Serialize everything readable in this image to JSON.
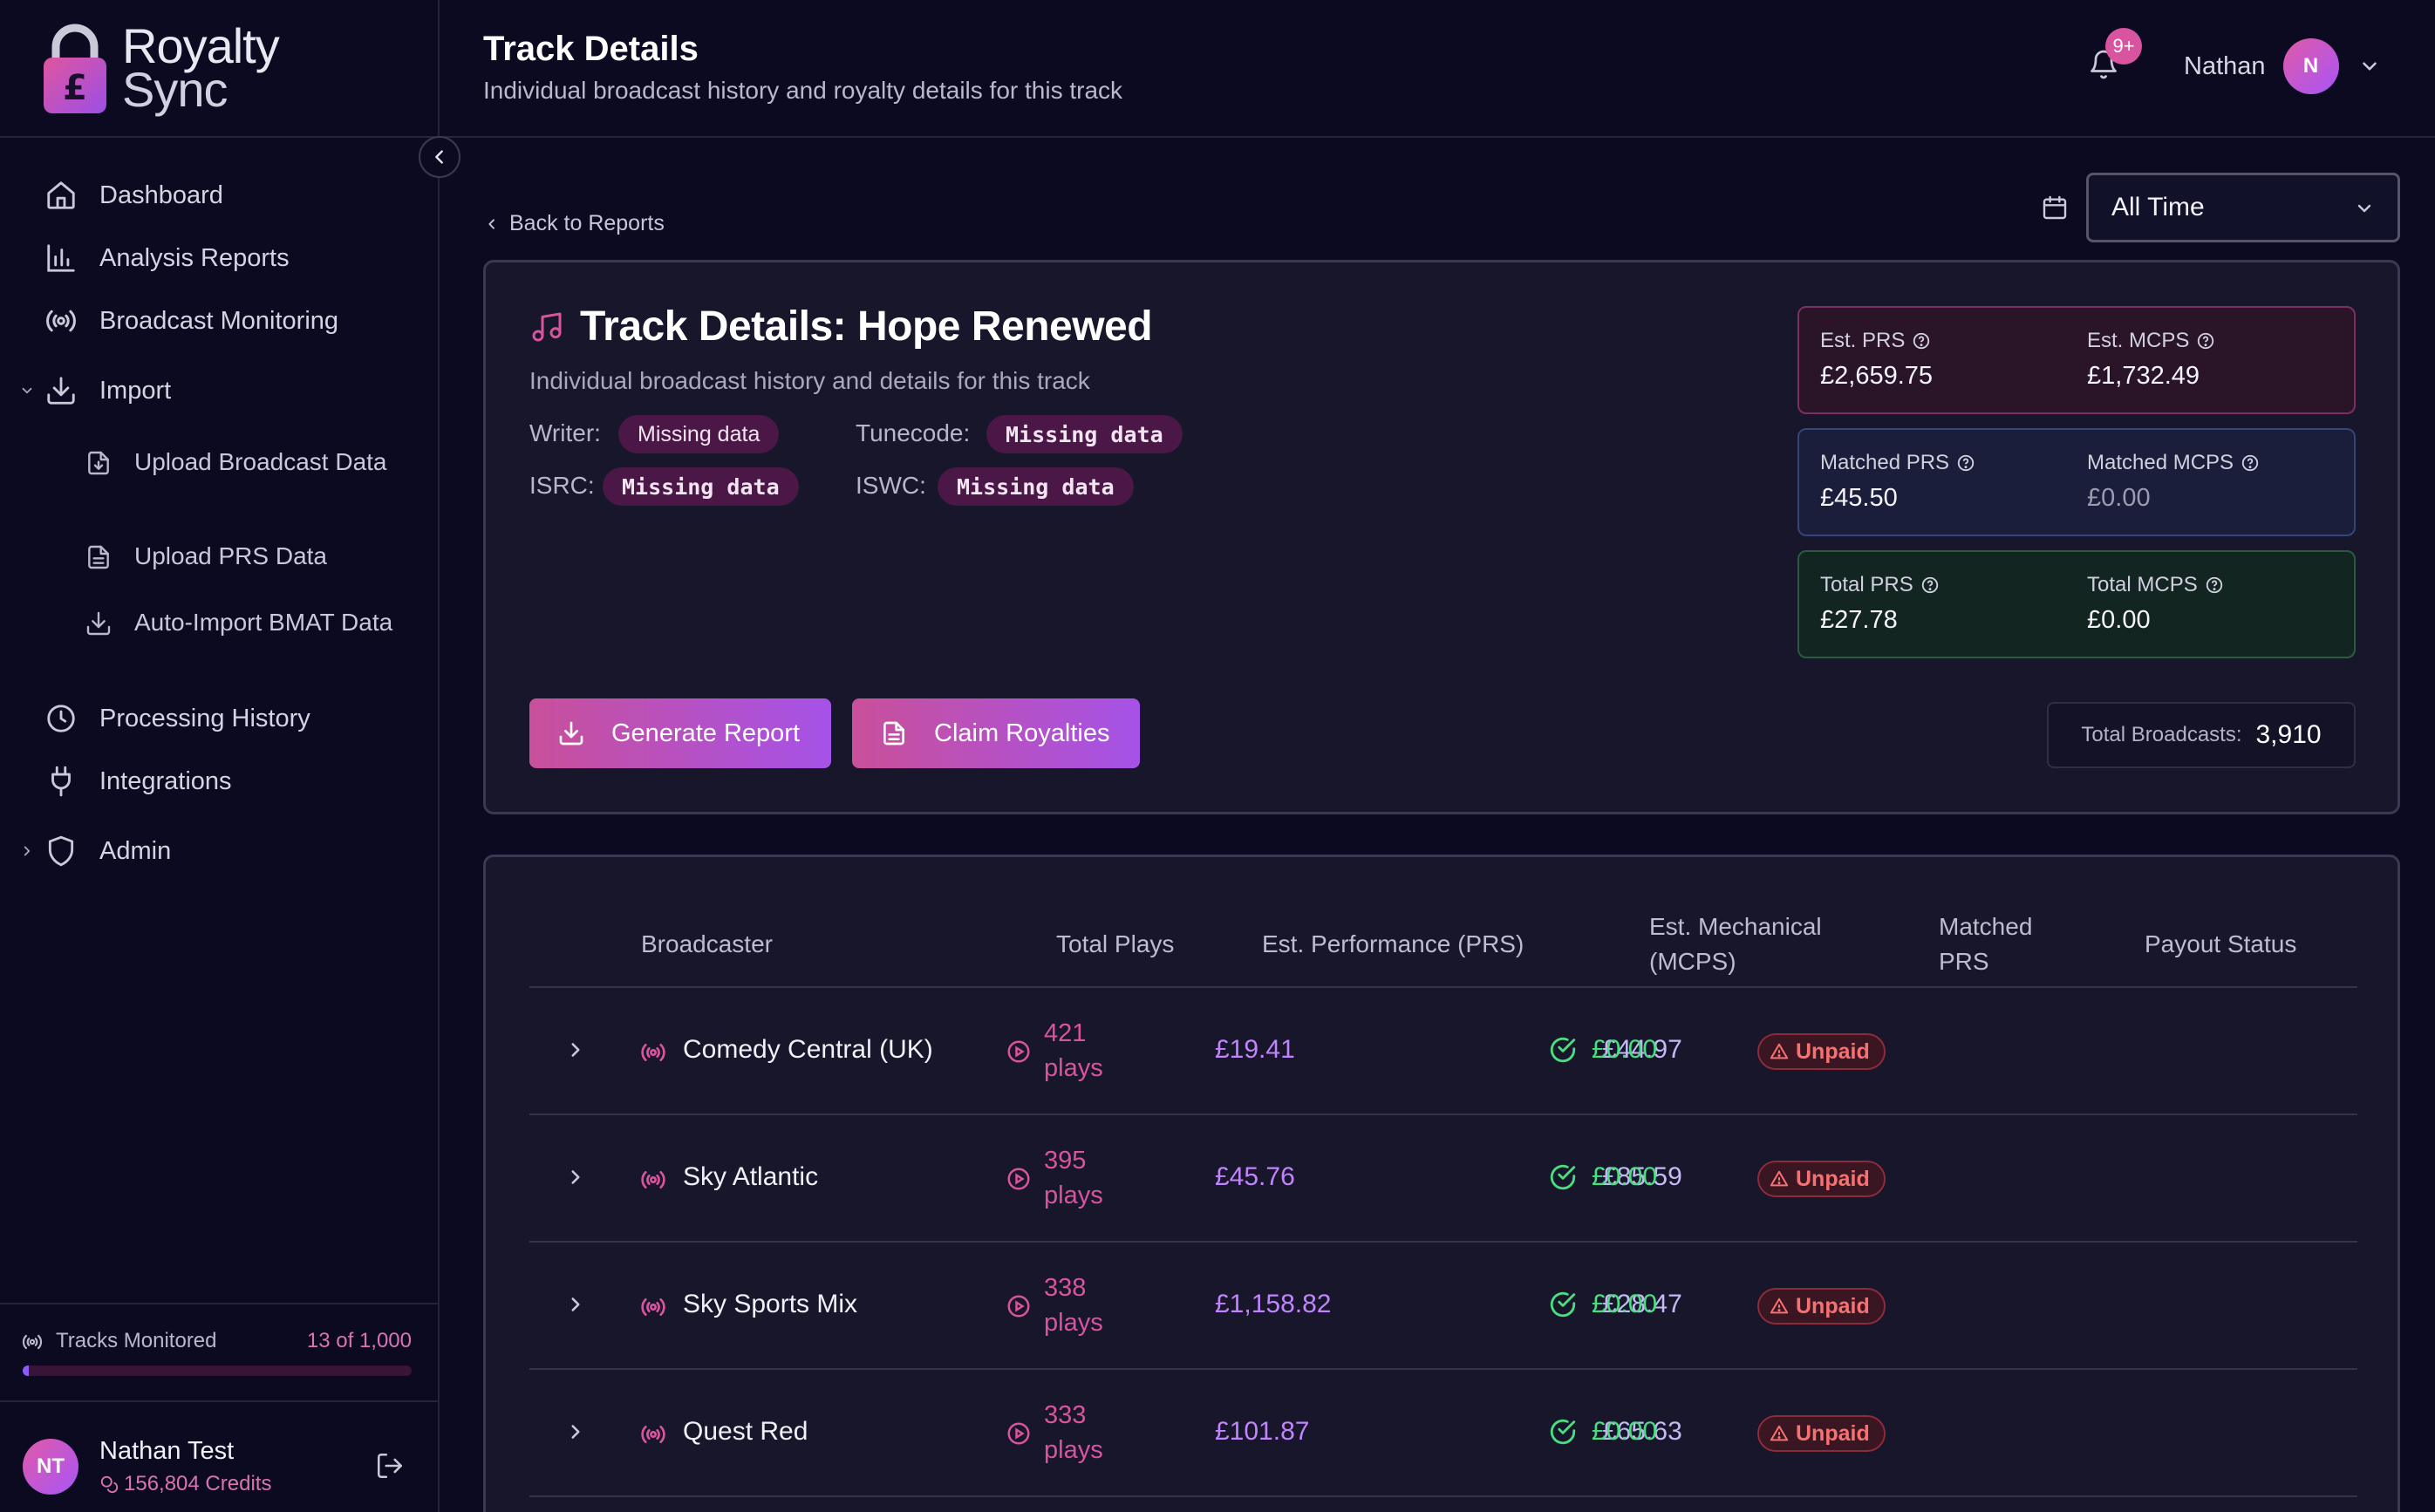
{
  "app": {
    "name_line1": "Royalty",
    "name_line2": "Sync"
  },
  "sidebar": {
    "items": [
      {
        "label": "Dashboard",
        "icon": "home-icon"
      },
      {
        "label": "Analysis Reports",
        "icon": "bar-chart-icon"
      },
      {
        "label": "Broadcast Monitoring",
        "icon": "radio-icon"
      },
      {
        "label": "Import",
        "icon": "download-icon",
        "expanded": true,
        "children": [
          {
            "label": "Upload Broadcast Data",
            "icon": "file-download-icon"
          },
          {
            "label": "Upload PRS Data",
            "icon": "file-text-icon"
          },
          {
            "label": "Auto-Import BMAT Data",
            "icon": "download-icon"
          }
        ]
      },
      {
        "label": "Processing History",
        "icon": "clock-icon"
      },
      {
        "label": "Integrations",
        "icon": "plug-icon"
      },
      {
        "label": "Admin",
        "icon": "shield-icon",
        "expanded": false
      }
    ],
    "tracks_monitored": {
      "label": "Tracks Monitored",
      "count_text": "13 of 1,000",
      "fraction": 0.013
    },
    "user": {
      "initials": "NT",
      "name": "Nathan Test",
      "credits": "156,804 Credits"
    }
  },
  "header": {
    "title": "Track Details",
    "subtitle": "Individual broadcast history and royalty details for this track",
    "notifications_badge": "9+",
    "user_name": "Nathan",
    "user_initial": "N"
  },
  "toolbar": {
    "back_label": "Back to Reports",
    "period_value": "All Time"
  },
  "track": {
    "title": "Track Details: Hope Renewed",
    "description": "Individual broadcast history and details for this track",
    "writer_label": "Writer:",
    "writer_value": "Missing data",
    "tunecode_label": "Tunecode:",
    "tunecode_value": "Missing data",
    "isrc_label": "ISRC:",
    "isrc_value": "Missing data",
    "iswc_label": "ISWC:",
    "iswc_value": "Missing data",
    "stats": {
      "est_prs_label": "Est. PRS",
      "est_prs_value": "£2,659.75",
      "est_mcps_label": "Est. MCPS",
      "est_mcps_value": "£1,732.49",
      "matched_prs_label": "Matched PRS",
      "matched_prs_value": "£45.50",
      "matched_mcps_label": "Matched MCPS",
      "matched_mcps_value": "£0.00",
      "total_prs_label": "Total PRS",
      "total_prs_value": "£27.78",
      "total_mcps_label": "Total MCPS",
      "total_mcps_value": "£0.00"
    },
    "generate_label": "Generate Report",
    "claim_label": "Claim Royalties",
    "total_broadcasts_label": "Total Broadcasts:",
    "total_broadcasts_value": "3,910"
  },
  "table": {
    "headers": {
      "broadcaster": "Broadcaster",
      "total_plays": "Total Plays",
      "est_performance": "Est. Performance (PRS)",
      "est_mechanical_1": "Est. Mechanical",
      "est_mechanical_2": "(MCPS)",
      "matched_1": "Matched",
      "matched_2": "PRS",
      "payout": "Payout Status"
    },
    "rows": [
      {
        "broadcaster": "Comedy Central (UK)",
        "plays_num": "421",
        "plays_unit": "plays",
        "prs": "£19.41",
        "mcps": "£44.97",
        "matched": "£0.00",
        "status": "Unpaid"
      },
      {
        "broadcaster": "Sky Atlantic",
        "plays_num": "395",
        "plays_unit": "plays",
        "prs": "£45.76",
        "mcps": "£85.59",
        "matched": "£0.00",
        "status": "Unpaid"
      },
      {
        "broadcaster": "Sky Sports Mix",
        "plays_num": "338",
        "plays_unit": "plays",
        "prs": "£1,158.82",
        "mcps": "£28.47",
        "matched": "£0.00",
        "status": "Unpaid"
      },
      {
        "broadcaster": "Quest Red",
        "plays_num": "333",
        "plays_unit": "plays",
        "prs": "£101.87",
        "mcps": "£65.63",
        "matched": "£0.00",
        "status": "Unpaid"
      }
    ]
  },
  "colors": {
    "background": "#0b0a21",
    "card": "#17162a",
    "accent_pink": "#d8549e",
    "accent_purple": "#a552e8",
    "success": "#4ade80",
    "danger": "#f87171"
  }
}
